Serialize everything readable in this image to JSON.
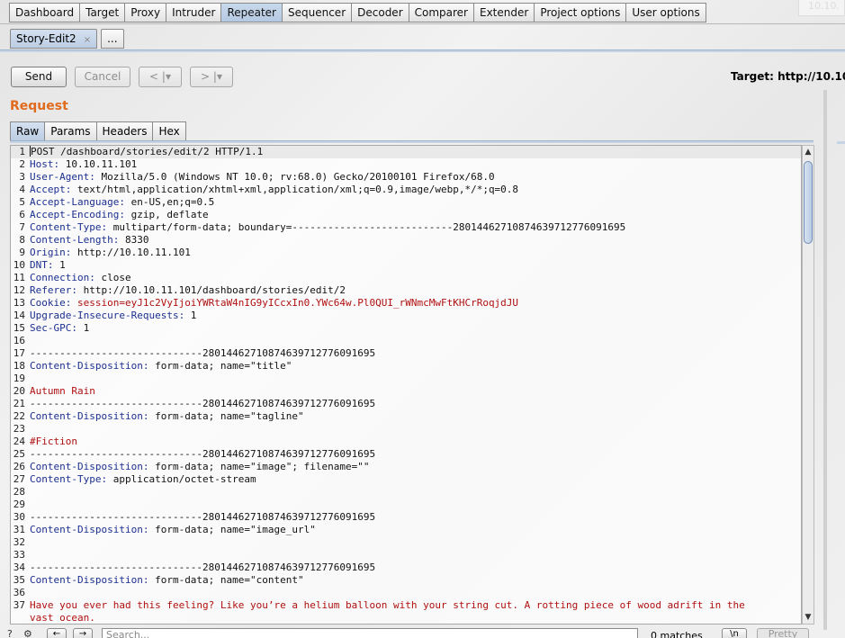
{
  "main_tabs": [
    "Dashboard",
    "Target",
    "Proxy",
    "Intruder",
    "Repeater",
    "Sequencer",
    "Decoder",
    "Comparer",
    "Extender",
    "Project options",
    "User options"
  ],
  "active_main_tab": "Repeater",
  "corner_text": "10.10.",
  "sub_tabs": {
    "active": "Story-Edit2",
    "close": "×",
    "more": "..."
  },
  "toolbar": {
    "send": "Send",
    "cancel": "Cancel",
    "back": "< |▾",
    "forward": "> |▾"
  },
  "target_label": "Target: http://10.10.",
  "request_title": "Request",
  "view_tabs": [
    "Raw",
    "Params",
    "Headers",
    "Hex"
  ],
  "active_view_tab": "Raw",
  "lines": [
    {
      "n": "1",
      "k": "",
      "v": "POST /dashboard/stories/edit/2 HTTP/1.1"
    },
    {
      "n": "2",
      "k": "Host:",
      "v": " 10.10.11.101"
    },
    {
      "n": "3",
      "k": "User-Agent:",
      "v": " Mozilla/5.0 (Windows NT 10.0; rv:68.0) Gecko/20100101 Firefox/68.0"
    },
    {
      "n": "4",
      "k": "Accept:",
      "v": " text/html,application/xhtml+xml,application/xml;q=0.9,image/webp,*/*;q=0.8"
    },
    {
      "n": "5",
      "k": "Accept-Language:",
      "v": " en-US,en;q=0.5"
    },
    {
      "n": "6",
      "k": "Accept-Encoding:",
      "v": " gzip, deflate"
    },
    {
      "n": "7",
      "k": "Content-Type:",
      "v": " multipart/form-data; boundary=---------------------------280144627108746397127760916​95"
    },
    {
      "n": "8",
      "k": "Content-Length:",
      "v": " 8330"
    },
    {
      "n": "9",
      "k": "Origin:",
      "v": " http://10.10.11.101"
    },
    {
      "n": "10",
      "k": "DNT:",
      "v": " 1"
    },
    {
      "n": "11",
      "k": "Connection:",
      "v": " close"
    },
    {
      "n": "12",
      "k": "Referer:",
      "v": " http://10.10.11.101/dashboard/stories/edit/2"
    },
    {
      "n": "13",
      "k": "Cookie:",
      "v": " session=eyJ1c2VyIjoiYWRtaW4nIG9yICcxIn0.YWc64w.Pl0QUI_rWNmcMwFtKHCrRoqjdJU",
      "cookie": true
    },
    {
      "n": "14",
      "k": "Upgrade-Insecure-Requests:",
      "v": " 1"
    },
    {
      "n": "15",
      "k": "Sec-GPC:",
      "v": " 1"
    },
    {
      "n": "16",
      "k": "",
      "v": ""
    },
    {
      "n": "17",
      "k": "",
      "v": "-----------------------------28014462710874639712776091695"
    },
    {
      "n": "18",
      "k": "Content-Disposition:",
      "v": " form-data; name=\"title\""
    },
    {
      "n": "19",
      "k": "",
      "v": ""
    },
    {
      "n": "20",
      "k": "",
      "v": "Autumn Rain",
      "red": true
    },
    {
      "n": "21",
      "k": "",
      "v": "-----------------------------28014462710874639712776091695"
    },
    {
      "n": "22",
      "k": "Content-Disposition:",
      "v": " form-data; name=\"tagline\""
    },
    {
      "n": "23",
      "k": "",
      "v": ""
    },
    {
      "n": "24",
      "k": "",
      "v": "#Fiction",
      "red": true
    },
    {
      "n": "25",
      "k": "",
      "v": "-----------------------------28014462710874639712776091695"
    },
    {
      "n": "26",
      "k": "Content-Disposition:",
      "v": " form-data; name=\"image\"; filename=\"\""
    },
    {
      "n": "27",
      "k": "Content-Type:",
      "v": " application/octet-stream"
    },
    {
      "n": "28",
      "k": "",
      "v": ""
    },
    {
      "n": "29",
      "k": "",
      "v": ""
    },
    {
      "n": "30",
      "k": "",
      "v": "-----------------------------28014462710874639712776091695"
    },
    {
      "n": "31",
      "k": "Content-Disposition:",
      "v": " form-data; name=\"image_url\""
    },
    {
      "n": "32",
      "k": "",
      "v": ""
    },
    {
      "n": "33",
      "k": "",
      "v": ""
    },
    {
      "n": "34",
      "k": "",
      "v": "-----------------------------28014462710874639712776091695"
    },
    {
      "n": "35",
      "k": "Content-Disposition:",
      "v": " form-data; name=\"content\""
    },
    {
      "n": "36",
      "k": "",
      "v": ""
    },
    {
      "n": "37",
      "k": "",
      "v": "Have you ever had this feeling? Like you’re a helium balloon with your string cut. A rotting piece of wood adrift in the",
      "red": true
    },
    {
      "n": "",
      "k": "",
      "v": "vast ocean.",
      "red": true
    }
  ],
  "search": {
    "placeholder": "Search..."
  },
  "matches": "0 matches",
  "newline_btn": "\\n",
  "pretty_btn": "Pretty"
}
